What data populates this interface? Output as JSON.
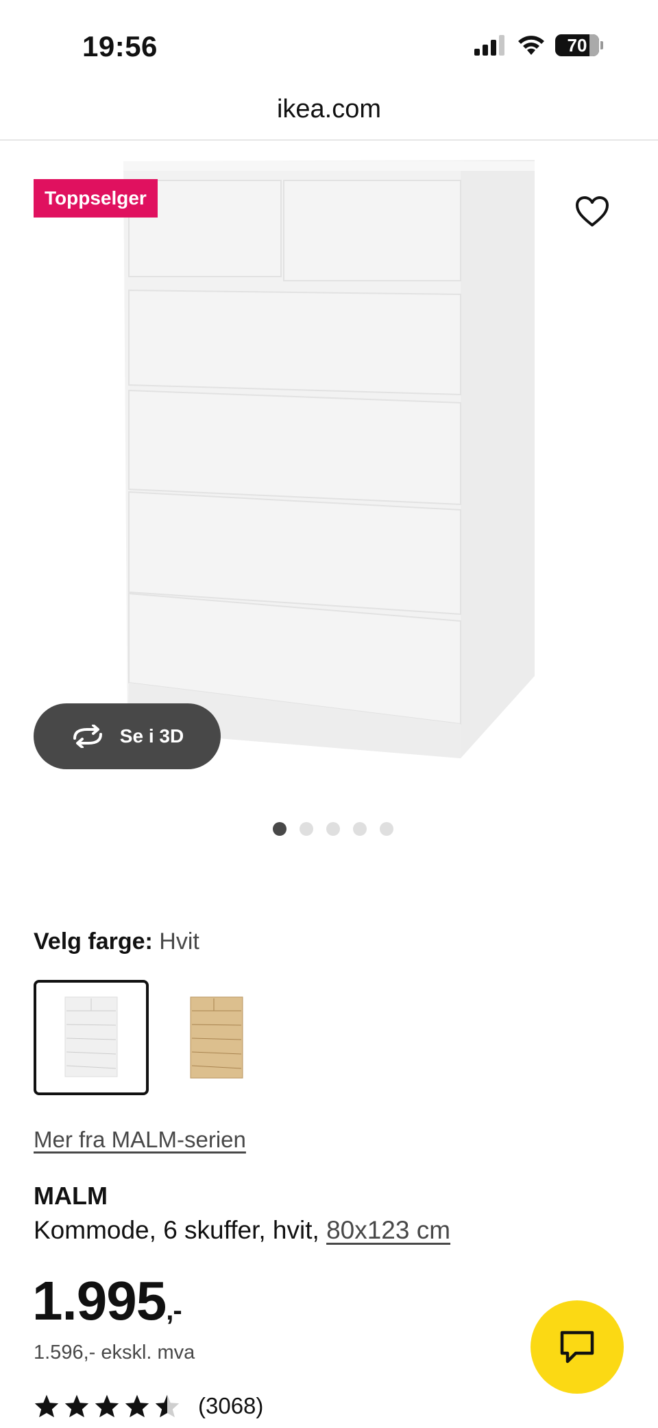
{
  "status_bar": {
    "time": "19:56",
    "battery": "70"
  },
  "browser": {
    "url": "ikea.com"
  },
  "hero": {
    "badge": "Toppselger",
    "view_3d_label": "Se i 3D",
    "carousel_count": 5,
    "carousel_active_index": 0
  },
  "color_picker": {
    "label": "Velg farge:",
    "value": "Hvit",
    "options": [
      "hvit",
      "eik"
    ]
  },
  "series_link": "Mer fra MALM-serien",
  "product": {
    "name": "MALM",
    "description": "Kommode, 6 skuffer, hvit, ",
    "dimensions": "80x123 cm",
    "price_main": "1.995",
    "price_suffix": ",-",
    "price_ex_vat": "1.596,- ekskl. mva",
    "rating_value": 4.5,
    "rating_count": "(3068)"
  },
  "colors": {
    "badge": "#e0115f",
    "chat": "#fbd914",
    "dark_button": "#484848"
  }
}
